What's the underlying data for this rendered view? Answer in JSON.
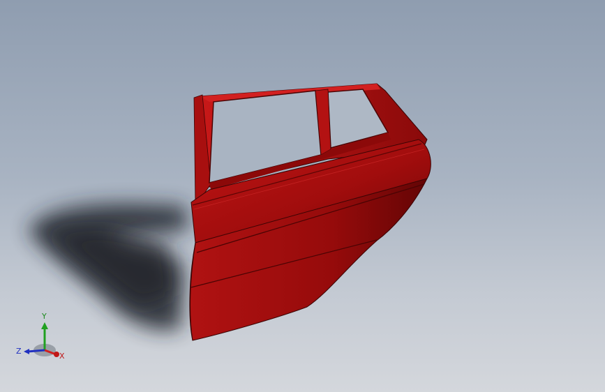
{
  "viewport": {
    "background_top": "#8f9db0",
    "background_bottom": "#d4d7dc"
  },
  "model": {
    "part_color": "#b01010",
    "part_shade": "#7a0808"
  },
  "triad": {
    "x_label": "X",
    "y_label": "Y",
    "z_label": "Z",
    "x_color": "#d02020",
    "y_color": "#20a020",
    "z_color": "#2030c0"
  }
}
